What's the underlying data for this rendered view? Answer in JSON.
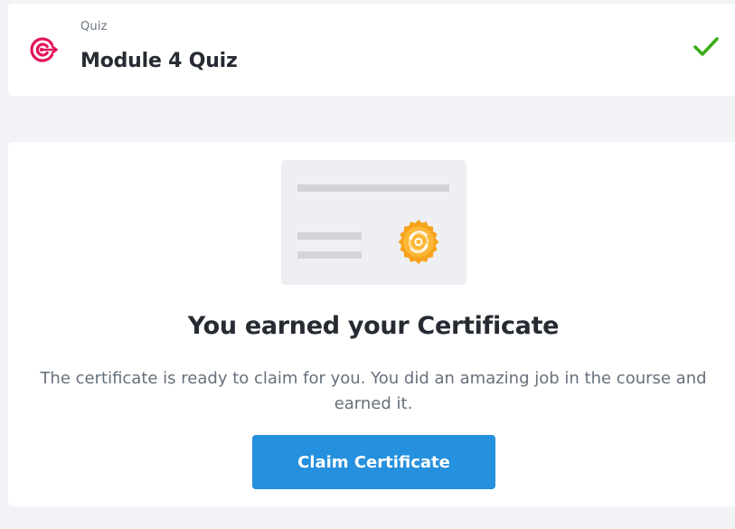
{
  "quiz_header": {
    "type_label": "Quiz",
    "title": "Module 4 Quiz",
    "icon": "target-icon",
    "status_icon": "check-icon",
    "accent_color": "#e3165b",
    "status_color": "#3cae1a"
  },
  "certificate": {
    "illustration": "certificate-illustration",
    "heading": "You earned your Certificate",
    "description": "The certificate is ready to claim for you. You did an amazing job in the course and earned it.",
    "button_label": "Claim Certificate",
    "button_color": "#2590de",
    "seal_color": "#f7a21b"
  }
}
